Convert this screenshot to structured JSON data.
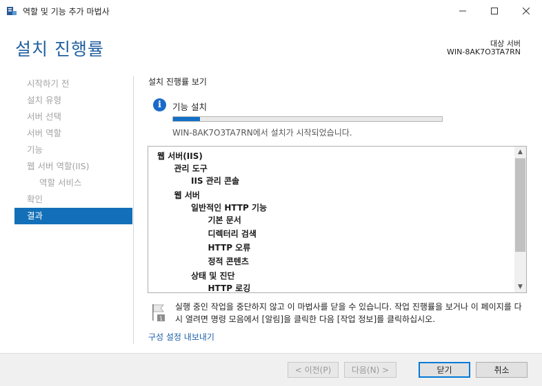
{
  "window": {
    "title": "역할 및 기능 추가 마법사",
    "controls": {
      "minimize": "minimize-icon",
      "maximize": "maximize-icon",
      "close": "close-icon"
    }
  },
  "header": {
    "page_title": "설치 진행률",
    "destination_label": "대상 서버",
    "destination_server": "WIN-8AK7O3TA7RN"
  },
  "sidebar": {
    "items": [
      {
        "label": "시작하기 전",
        "state": "disabled"
      },
      {
        "label": "설치 유형",
        "state": "disabled"
      },
      {
        "label": "서버 선택",
        "state": "disabled"
      },
      {
        "label": "서버 역할",
        "state": "disabled"
      },
      {
        "label": "기능",
        "state": "disabled"
      },
      {
        "label": "웹 서버 역할(IIS)",
        "state": "disabled"
      },
      {
        "label": "역할 서비스",
        "state": "disabled"
      },
      {
        "label": "확인",
        "state": "disabled"
      },
      {
        "label": "결과",
        "state": "active"
      }
    ]
  },
  "main": {
    "section_title": "설치 진행률 보기",
    "feature_label": "기능 설치",
    "progress": 0.1,
    "status_text": "WIN-8AK7O3TA7RN에서 설치가 시작되었습니다.",
    "feature_tree": [
      {
        "label": "웹 서버(IIS)",
        "level": 0
      },
      {
        "label": "관리 도구",
        "level": 1
      },
      {
        "label": "IIS 관리 콘솔",
        "level": 2
      },
      {
        "label": "웹 서버",
        "level": 1
      },
      {
        "label": "일반적인 HTTP 기능",
        "level": 2
      },
      {
        "label": "기본 문서",
        "level": 3
      },
      {
        "label": "디렉터리 검색",
        "level": 3
      },
      {
        "label": "HTTP 오류",
        "level": 3
      },
      {
        "label": "정적 콘텐츠",
        "level": 3
      },
      {
        "label": "상태 및 진단",
        "level": 2
      },
      {
        "label": "HTTP 로깅",
        "level": 3
      }
    ],
    "notice_badge": "1",
    "notice_text": "실행 중인 작업을 중단하지 않고 이 마법사를 닫을 수 있습니다. 작업 진행률을 보거나 이 페이지를 다시 열려면 명령 모음에서 [알림]을 클릭한 다음 [작업 정보]를 클릭하십시오.",
    "export_link": "구성 설정 내보내기"
  },
  "footer": {
    "previous_label": "< 이전(P)",
    "next_label": "다음(N) >",
    "close_label": "닫기",
    "cancel_label": "취소"
  },
  "colors": {
    "title_blue": "#1f5fa0",
    "nav_active_bg": "#1370b8",
    "progress_fill": "#1270c6",
    "info_icon": "#1b6ac9",
    "link": "#1c5fa8"
  }
}
